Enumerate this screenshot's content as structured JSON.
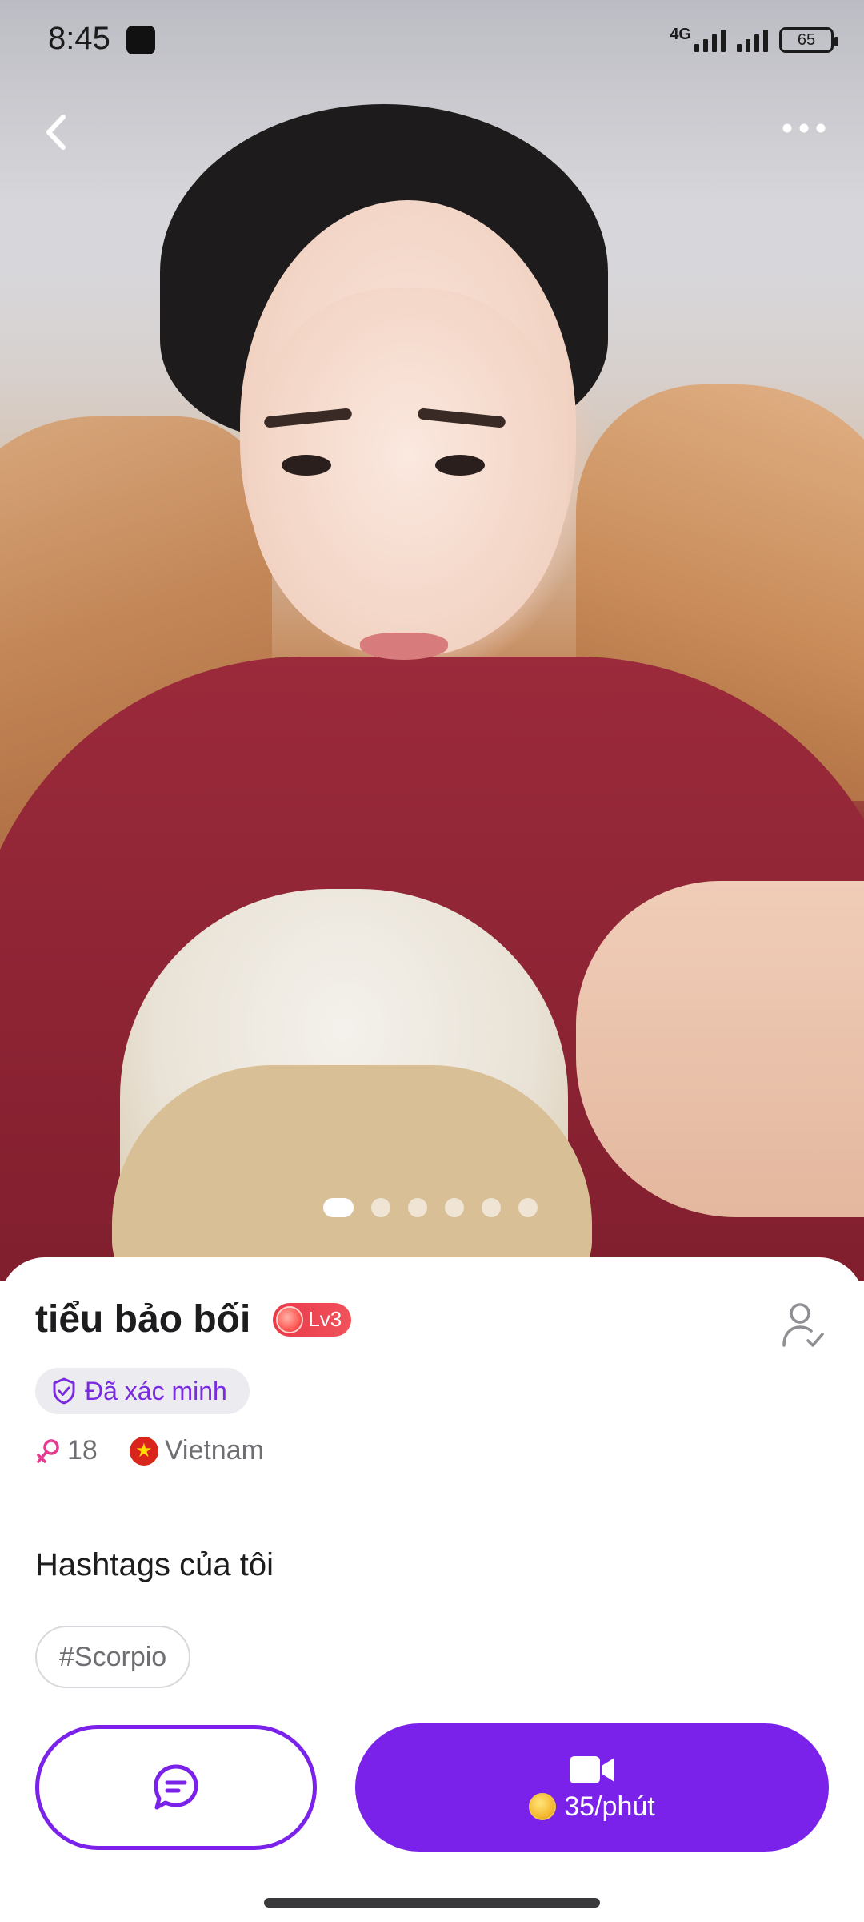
{
  "status_bar": {
    "time": "8:45",
    "network": "4G",
    "battery": "65"
  },
  "profile": {
    "name": "tiểu bảo bối",
    "level": "Lv3",
    "verified_label": "Đã xác minh",
    "age": "18",
    "country": "Vietnam"
  },
  "gallery": {
    "photo_count": 6,
    "active_index": 0
  },
  "hashtags": {
    "title": "Hashtags của tôi",
    "items": [
      "#Scorpio"
    ]
  },
  "actions": {
    "call_price": "35/phút"
  },
  "colors": {
    "accent": "#7b22ea",
    "level_badge": "#e9394a",
    "gender_icon": "#e6398f",
    "verified_text": "#7a2be0"
  },
  "icons": {
    "back": "chevron-left-icon",
    "more": "more-horizontal-icon",
    "follow": "user-check-icon",
    "verified": "shield-check-icon",
    "gender": "female-icon",
    "flag": "vietnam-flag-icon",
    "chat": "chat-bubble-icon",
    "video": "video-camera-icon",
    "coin": "coin-icon"
  }
}
